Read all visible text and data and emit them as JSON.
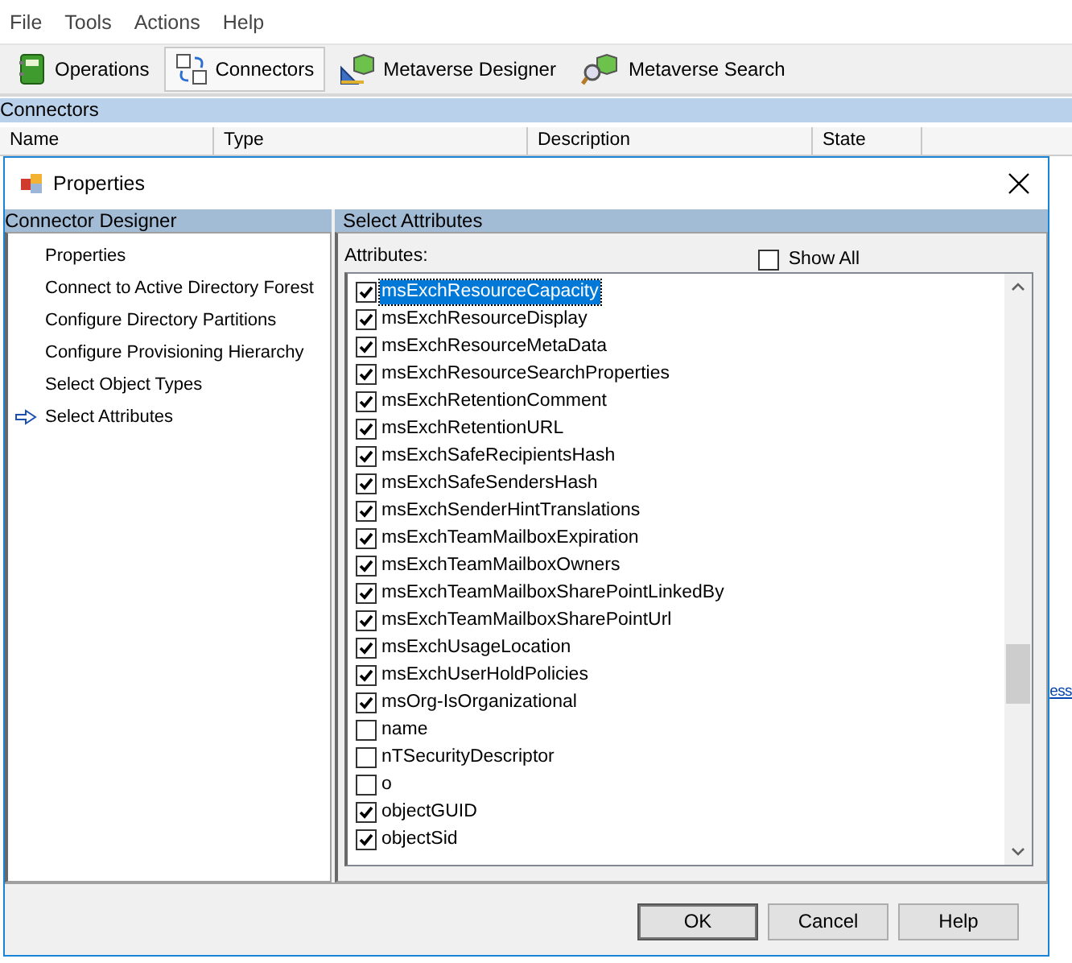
{
  "menu": [
    "File",
    "Tools",
    "Actions",
    "Help"
  ],
  "toolbar": [
    {
      "label": "Operations",
      "kind": "operations",
      "selected": false
    },
    {
      "label": "Connectors",
      "kind": "connectors",
      "selected": true
    },
    {
      "label": "Metaverse Designer",
      "kind": "designer",
      "selected": false
    },
    {
      "label": "Metaverse Search",
      "kind": "search",
      "selected": false
    }
  ],
  "section_title": "Connectors",
  "table": {
    "columns": [
      "Name",
      "Type",
      "Description",
      "State"
    ]
  },
  "background_link": "ess",
  "dialog": {
    "title": "Properties",
    "nav_title": "Connector Designer",
    "nav_items": [
      {
        "label": "Properties",
        "selected": false
      },
      {
        "label": "Connect to Active Directory Forest",
        "selected": false
      },
      {
        "label": "Configure Directory Partitions",
        "selected": false
      },
      {
        "label": "Configure Provisioning Hierarchy",
        "selected": false
      },
      {
        "label": "Select Object Types",
        "selected": false
      },
      {
        "label": "Select Attributes",
        "selected": true
      }
    ],
    "panel_title": "Select Attributes",
    "list_label": "Attributes:",
    "show_all": {
      "label": "Show All",
      "checked": false
    },
    "attributes": [
      {
        "name": "msExchResourceCapacity",
        "checked": true,
        "selected": true
      },
      {
        "name": "msExchResourceDisplay",
        "checked": true,
        "selected": false
      },
      {
        "name": "msExchResourceMetaData",
        "checked": true,
        "selected": false
      },
      {
        "name": "msExchResourceSearchProperties",
        "checked": true,
        "selected": false
      },
      {
        "name": "msExchRetentionComment",
        "checked": true,
        "selected": false
      },
      {
        "name": "msExchRetentionURL",
        "checked": true,
        "selected": false
      },
      {
        "name": "msExchSafeRecipientsHash",
        "checked": true,
        "selected": false
      },
      {
        "name": "msExchSafeSendersHash",
        "checked": true,
        "selected": false
      },
      {
        "name": "msExchSenderHintTranslations",
        "checked": true,
        "selected": false
      },
      {
        "name": "msExchTeamMailboxExpiration",
        "checked": true,
        "selected": false
      },
      {
        "name": "msExchTeamMailboxOwners",
        "checked": true,
        "selected": false
      },
      {
        "name": "msExchTeamMailboxSharePointLinkedBy",
        "checked": true,
        "selected": false
      },
      {
        "name": "msExchTeamMailboxSharePointUrl",
        "checked": true,
        "selected": false
      },
      {
        "name": "msExchUsageLocation",
        "checked": true,
        "selected": false
      },
      {
        "name": "msExchUserHoldPolicies",
        "checked": true,
        "selected": false
      },
      {
        "name": "msOrg-IsOrganizational",
        "checked": true,
        "selected": false
      },
      {
        "name": "name",
        "checked": false,
        "selected": false
      },
      {
        "name": "nTSecurityDescriptor",
        "checked": false,
        "selected": false
      },
      {
        "name": "o",
        "checked": false,
        "selected": false
      },
      {
        "name": "objectGUID",
        "checked": true,
        "selected": false
      },
      {
        "name": "objectSid",
        "checked": true,
        "selected": false
      }
    ],
    "buttons": [
      "OK",
      "Cancel",
      "Help"
    ]
  }
}
